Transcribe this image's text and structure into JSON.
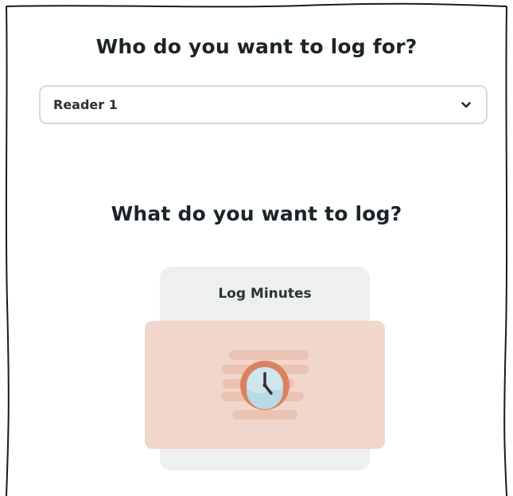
{
  "who_section": {
    "heading": "Who do you want to log for?",
    "reader_select": {
      "selected": "Reader 1",
      "icon": "chevron-down-icon"
    }
  },
  "what_section": {
    "heading": "What do you want to log?",
    "options": [
      {
        "label": "Log Minutes",
        "icon": "clock-icon"
      }
    ]
  },
  "colors": {
    "card_background": "#eef0f0",
    "illustration_background": "#f1d6cb",
    "clock_ring": "#d9825f",
    "clock_face": "#cfe6ee"
  }
}
